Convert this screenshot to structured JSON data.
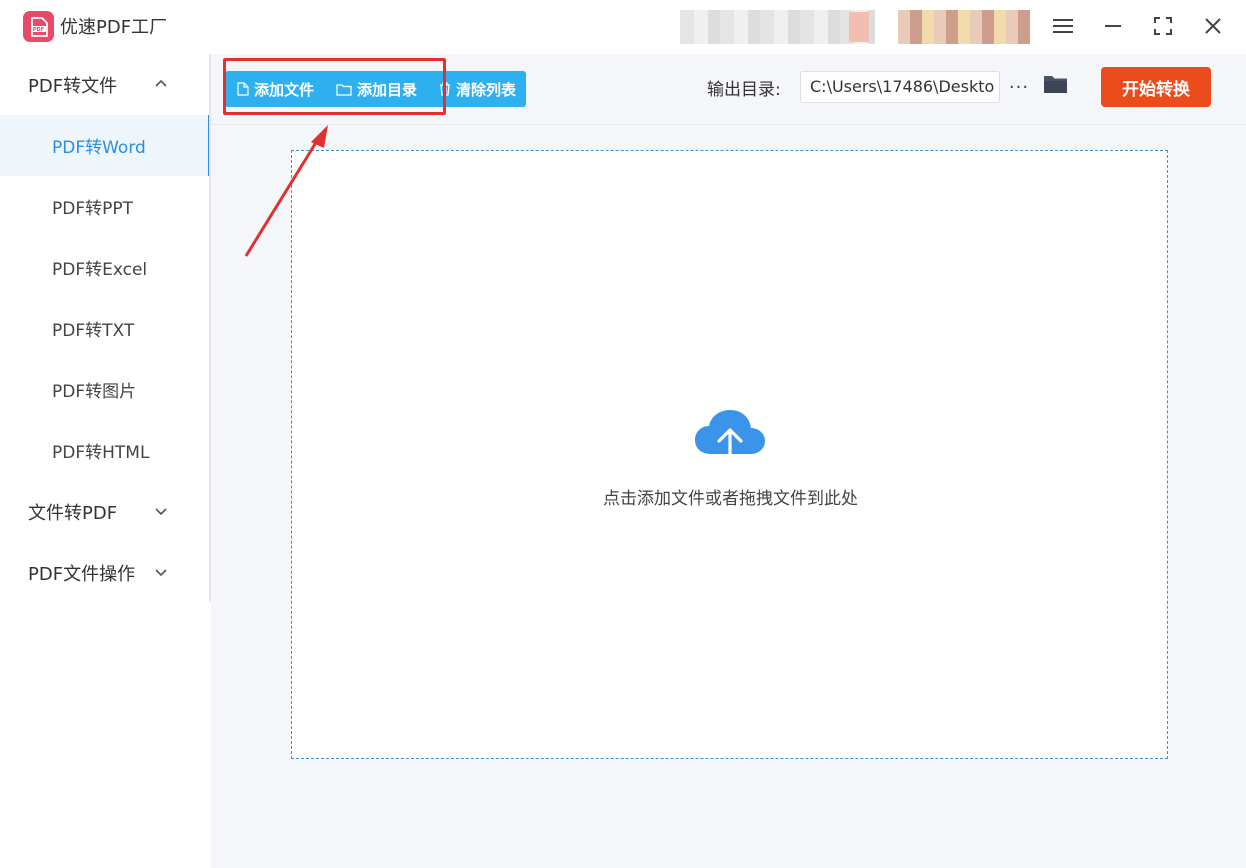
{
  "app": {
    "title": "优速PDF工厂",
    "logo_text": "PDF"
  },
  "window_controls": {
    "menu_icon": "hamburger-menu-icon",
    "minimize_icon": "minimize-icon",
    "maximize_icon": "fullscreen-icon",
    "close_icon": "close-icon"
  },
  "sidebar": {
    "groups": [
      {
        "label": "PDF转文件",
        "expanded": true,
        "items": [
          {
            "label": "PDF转Word",
            "active": true
          },
          {
            "label": "PDF转PPT",
            "active": false
          },
          {
            "label": "PDF转Excel",
            "active": false
          },
          {
            "label": "PDF转TXT",
            "active": false
          },
          {
            "label": "PDF转图片",
            "active": false
          },
          {
            "label": "PDF转HTML",
            "active": false
          }
        ]
      },
      {
        "label": "文件转PDF",
        "expanded": false
      },
      {
        "label": "PDF文件操作",
        "expanded": false
      }
    ]
  },
  "toolbar": {
    "add_file_label": "添加文件",
    "add_folder_label": "添加目录",
    "clear_list_label": "清除列表",
    "output_label": "输出目录:",
    "output_path": "C:\\Users\\17486\\Deskto",
    "more_label": "···",
    "start_label": "开始转换"
  },
  "drop_zone": {
    "text": "点击添加文件或者拖拽文件到此处",
    "icon": "cloud-upload-icon"
  },
  "colors": {
    "accent_blue": "#2eaff0",
    "active_blue": "#2b8ee0",
    "start_orange": "#ec4b1c",
    "highlight_red": "#e23030",
    "logo_pink": "#ea4a6a"
  }
}
